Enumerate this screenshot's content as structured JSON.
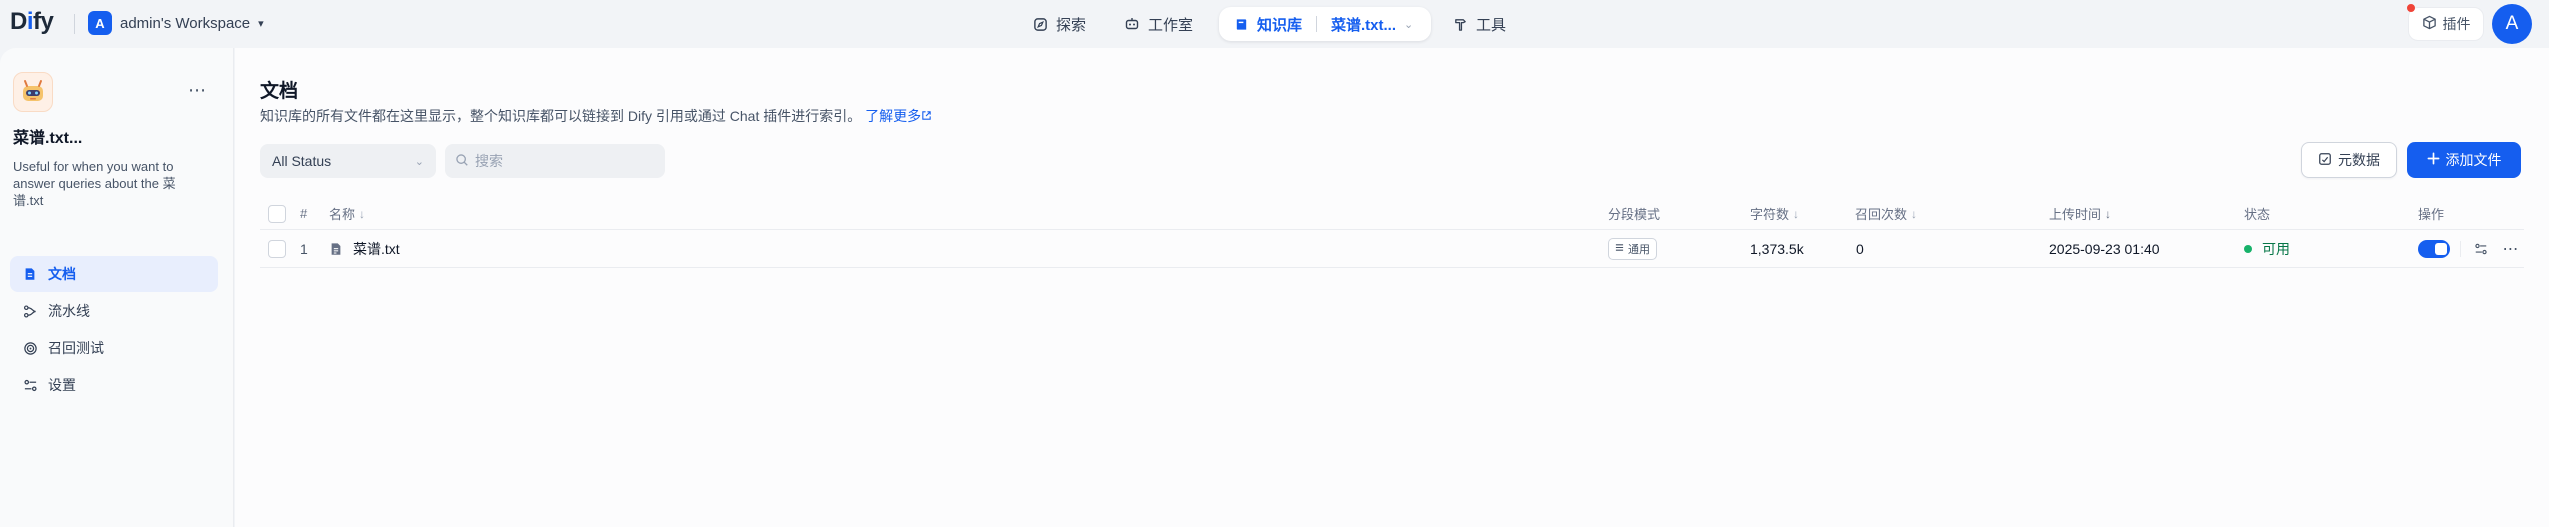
{
  "header": {
    "logo": {
      "prefix": "D",
      "accent": "i",
      "suffix": "fy"
    },
    "workspace": {
      "avatar": "A",
      "name": "admin's Workspace"
    },
    "nav": {
      "explore": "探索",
      "studio": "工作室",
      "knowledge": "知识库",
      "current_kb": "菜谱.txt...",
      "tools": "工具"
    },
    "plugins": "插件",
    "user_avatar": "A"
  },
  "sidebar": {
    "kb_name": "菜谱.txt...",
    "kb_description": "Useful for when you want to answer queries about the 菜谱.txt",
    "items": [
      {
        "label": "文档",
        "icon": "document-icon",
        "active": true
      },
      {
        "label": "流水线",
        "icon": "pipeline-icon",
        "active": false
      },
      {
        "label": "召回测试",
        "icon": "target-icon",
        "active": false
      },
      {
        "label": "设置",
        "icon": "settings-icon",
        "active": false
      }
    ]
  },
  "main": {
    "title": "文档",
    "description": "知识库的所有文件都在这里显示，整个知识库都可以链接到 Dify 引用或通过 Chat 插件进行索引。",
    "learn_more": "了解更多",
    "status_filter": "All Status",
    "search_placeholder": "搜索",
    "metadata_button": "元数据",
    "add_button": "添加文件",
    "columns": {
      "index": "#",
      "name": "名称",
      "chunk_mode": "分段模式",
      "word_count": "字符数",
      "hit_count": "召回次数",
      "upload_time": "上传时间",
      "status": "状态",
      "actions": "操作"
    },
    "rows": [
      {
        "index": "1",
        "name": "菜谱.txt",
        "chunk_mode": "通用",
        "word_count": "1,373.5k",
        "hit_count": "0",
        "upload_time": "2025-09-23 01:40",
        "status": "可用",
        "enabled": true
      }
    ]
  },
  "colors": {
    "primary": "#155eef",
    "status_available": "#17b26a",
    "notification": "#f04438"
  }
}
